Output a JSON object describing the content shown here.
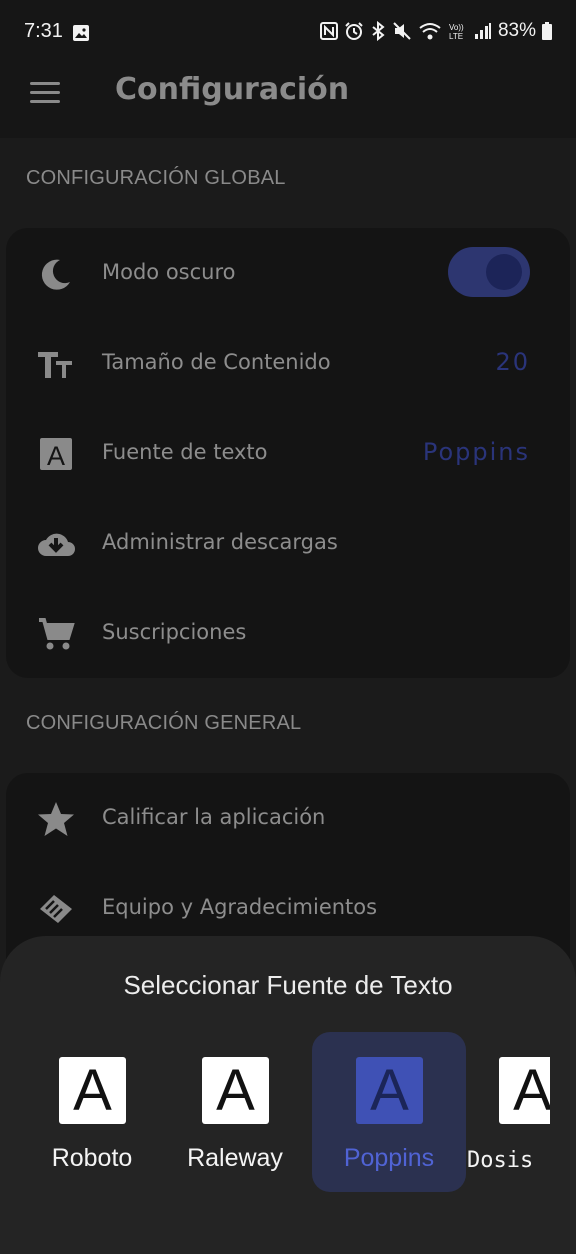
{
  "status_bar": {
    "time": "7:31",
    "battery": "83%",
    "icons": [
      "image-icon",
      "nfc-icon",
      "alarm-icon",
      "bluetooth-icon",
      "mute-icon",
      "wifi-icon",
      "volte-icon",
      "signal-icon",
      "battery-icon"
    ]
  },
  "app_bar": {
    "title": "Configuración"
  },
  "global_section": {
    "title": "CONFIGURACIÓN GLOBAL",
    "items": [
      {
        "label": "Modo oscuro",
        "icon": "moon-icon",
        "toggle_on": true
      },
      {
        "label": "Tamaño de Contenido",
        "icon": "text-size-icon",
        "value": "20"
      },
      {
        "label": "Fuente de texto",
        "icon": "font-icon",
        "value": "Poppins"
      },
      {
        "label": "Administrar descargas",
        "icon": "cloud-download-icon"
      },
      {
        "label": "Suscripciones",
        "icon": "cart-icon"
      }
    ]
  },
  "general_section": {
    "title": "CONFIGURACIÓN GENERAL",
    "items": [
      {
        "label": "Calificar la aplicación",
        "icon": "star-icon"
      },
      {
        "label": "Equipo y Agradecimientos",
        "icon": "handshake-icon"
      }
    ]
  },
  "font_sheet": {
    "title": "Seleccionar Fuente de Texto",
    "glyph": "A",
    "options": [
      {
        "name": "Roboto"
      },
      {
        "name": "Raleway"
      },
      {
        "name": "Poppins"
      },
      {
        "name": "Dosis"
      }
    ],
    "selected": "Poppins"
  },
  "colors": {
    "accent": "#3f51b5",
    "background": "#1b1b1b",
    "card": "#141414",
    "sheet": "#242424"
  }
}
